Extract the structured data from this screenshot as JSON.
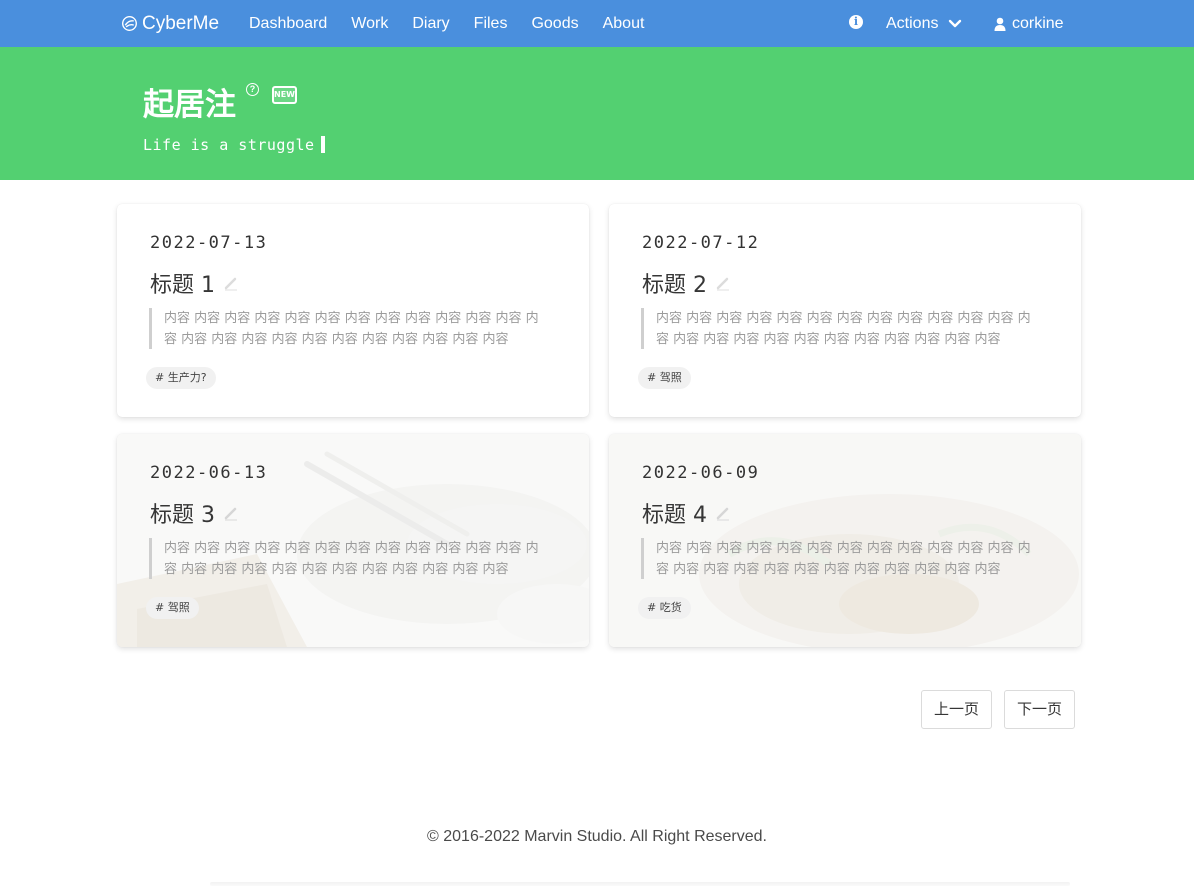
{
  "navbar": {
    "brand": "CyberMe",
    "links": [
      "Dashboard",
      "Work",
      "Diary",
      "Files",
      "Goods",
      "About"
    ],
    "actions_label": "Actions",
    "user_name": "corkine",
    "color": "#4a8fdd"
  },
  "hero": {
    "title": "起居注",
    "badge": "NEW",
    "subtitle": "Life is a struggle",
    "color": "#53d071"
  },
  "cards": [
    {
      "date": "2022-07-13",
      "title": "标题 1",
      "content": "内容 内容 内容 内容 内容 内容 内容 内容 内容 内容 内容 内容 内容 内容 内容 内容 内容 内容 内容 内容 内容 内容 内容 内容",
      "tag": "# 生产力?"
    },
    {
      "date": "2022-07-12",
      "title": "标题 2",
      "content": "内容 内容 内容 内容 内容 内容 内容 内容 内容 内容 内容 内容 内容 内容 内容 内容 内容 内容 内容 内容 内容 内容 内容 内容",
      "tag": "# 驾照"
    },
    {
      "date": "2022-06-13",
      "title": "标题 3",
      "content": "内容 内容 内容 内容 内容 内容 内容 内容 内容 内容 内容 内容 内容 内容 内容 内容 内容 内容 内容 内容 内容 内容 内容 内容",
      "tag": "# 驾照"
    },
    {
      "date": "2022-06-09",
      "title": "标题 4",
      "content": "内容 内容 内容 内容 内容 内容 内容 内容 内容 内容 内容 内容 内容 内容 内容 内容 内容 内容 内容 内容 内容 内容 内容 内容",
      "tag": "# 吃货"
    }
  ],
  "pagination": {
    "prev": "上一页",
    "next": "下一页"
  },
  "footer": {
    "text": "© 2016-2022 Marvin Studio. All Right Reserved."
  }
}
